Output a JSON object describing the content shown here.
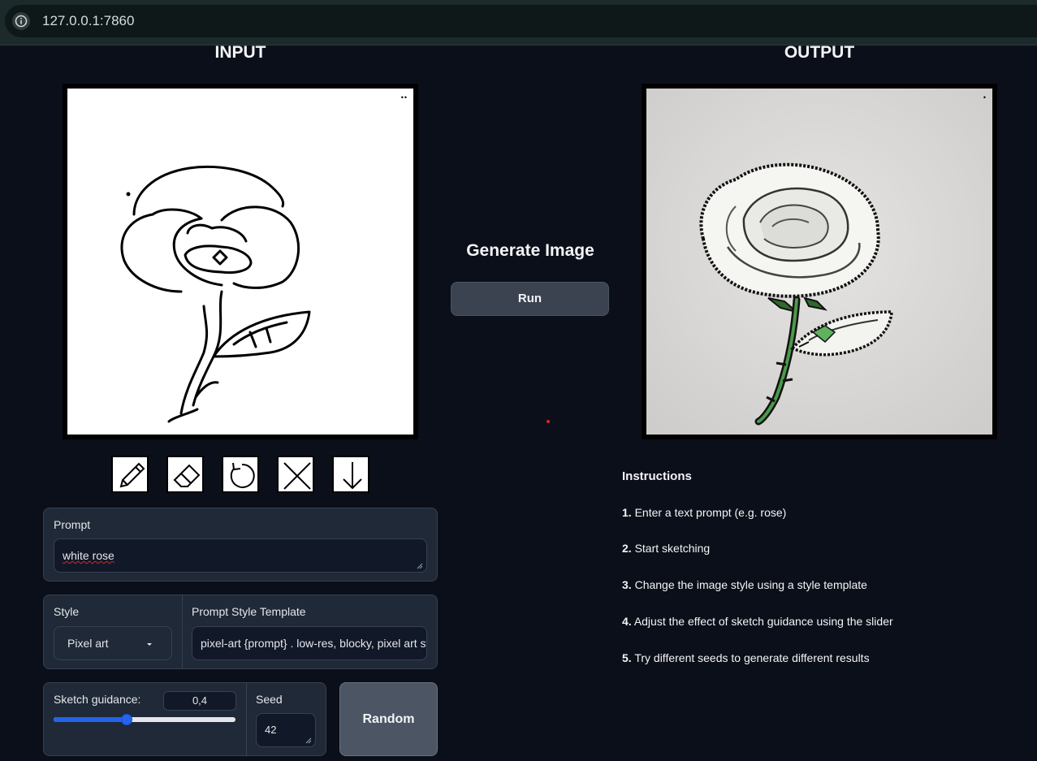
{
  "browser": {
    "url": "127.0.0.1:7860"
  },
  "input_section": {
    "title": "INPUT",
    "canvas_menu": "••"
  },
  "output_section": {
    "title": "OUTPUT",
    "image_description": "generated white rose image"
  },
  "generate": {
    "title": "Generate Image",
    "run_label": "Run"
  },
  "toolbar": {
    "tools": [
      "pencil-icon",
      "eraser-icon",
      "undo-icon",
      "clear-icon",
      "download-icon"
    ]
  },
  "prompt": {
    "label": "Prompt",
    "value": "white rose"
  },
  "style": {
    "label": "Style",
    "selected": "Pixel art",
    "template_label": "Prompt Style Template",
    "template_value": "pixel-art {prompt} . low-res, blocky, pixel art st"
  },
  "sketch_guidance": {
    "label": "Sketch guidance:",
    "value": "0,4",
    "fraction": 0.4
  },
  "seed": {
    "label": "Seed",
    "value": "42",
    "random_label": "Random"
  },
  "instructions": {
    "heading": "Instructions",
    "steps": [
      {
        "num": "1.",
        "text": "Enter a text prompt (e.g. rose)"
      },
      {
        "num": "2.",
        "text": "Start sketching"
      },
      {
        "num": "3.",
        "text": "Change the image style using a style template"
      },
      {
        "num": "4.",
        "text": "Adjust the effect of sketch guidance using the slider"
      },
      {
        "num": "5.",
        "text": "Try different seeds to generate different results"
      }
    ]
  },
  "colors": {
    "accent": "#2563eb",
    "background": "#0b0f19",
    "panel": "#1f2937"
  }
}
